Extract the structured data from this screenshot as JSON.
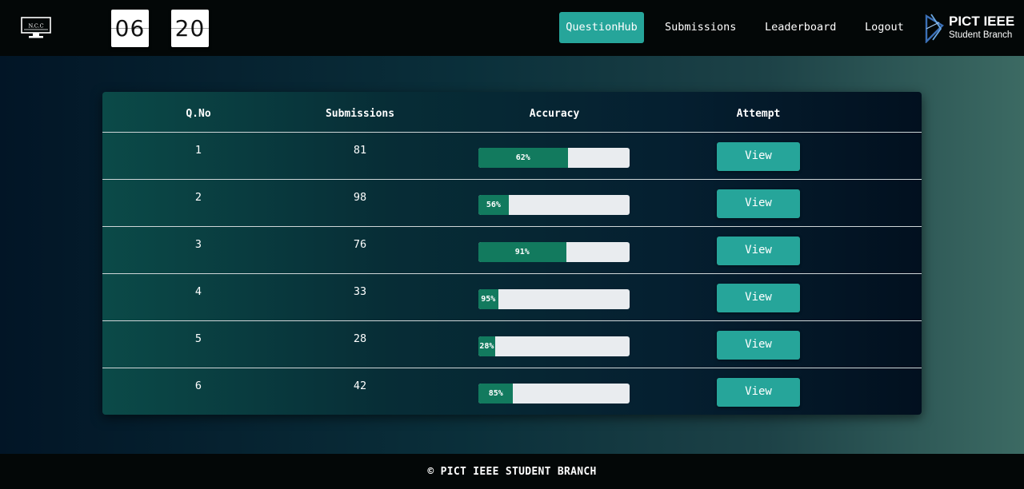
{
  "header": {
    "logo_text": "N.C.C",
    "timer": {
      "minutes": "06",
      "seconds": "20"
    },
    "nav": {
      "question_hub": "QuestionHub",
      "submissions": "Submissions",
      "leaderboard": "Leaderboard",
      "logout": "Logout"
    },
    "branding": {
      "title": "PICT IEEE",
      "subtitle": "Student Branch"
    }
  },
  "table": {
    "columns": [
      "Q.No",
      "Submissions",
      "Accuracy",
      "Attempt"
    ],
    "rows": [
      {
        "qno": "1",
        "submissions": "81",
        "accuracy_label": "62%",
        "accuracy_fill": 0.59,
        "action": "View"
      },
      {
        "qno": "2",
        "submissions": "98",
        "accuracy_label": "56%",
        "accuracy_fill": 0.2,
        "action": "View"
      },
      {
        "qno": "3",
        "submissions": "76",
        "accuracy_label": "91%",
        "accuracy_fill": 0.58,
        "action": "View"
      },
      {
        "qno": "4",
        "submissions": "33",
        "accuracy_label": "95%",
        "accuracy_fill": 0.13,
        "action": "View"
      },
      {
        "qno": "5",
        "submissions": "28",
        "accuracy_label": "28%",
        "accuracy_fill": 0.11,
        "action": "View"
      },
      {
        "qno": "6",
        "submissions": "42",
        "accuracy_label": "85%",
        "accuracy_fill": 0.23,
        "action": "View"
      }
    ]
  },
  "footer": {
    "text": "© PICT IEEE STUDENT BRANCH"
  },
  "colors": {
    "accent": "#26a59a",
    "bar_fill": "#127a5e",
    "bar_track": "#e9ecef",
    "navbar": "#030707"
  }
}
